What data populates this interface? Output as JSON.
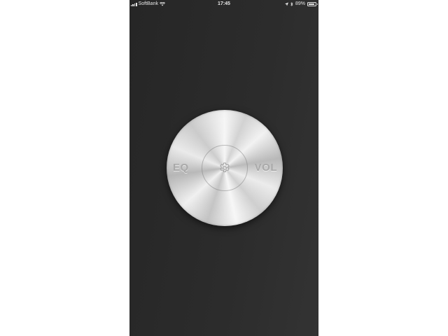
{
  "status_bar": {
    "carrier": "SoftBank",
    "time": "17:45",
    "battery_percent": "89%",
    "battery_level": 0.89,
    "icons": [
      "signal-icon",
      "wifi-icon",
      "location-icon",
      "bluetooth-icon",
      "battery-icon"
    ]
  },
  "knob": {
    "left_label": "EQ",
    "right_label": "VOL",
    "center_icon": "gear-icon"
  },
  "colors": {
    "background": "#2b2b2b",
    "knob_label": "#a9a9a9",
    "status_text": "#e8e8e8"
  }
}
